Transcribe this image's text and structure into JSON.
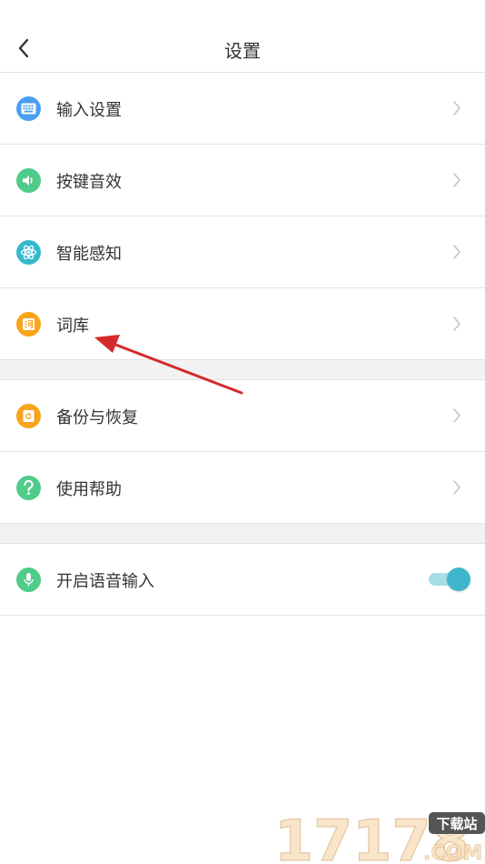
{
  "header": {
    "title": "设置"
  },
  "group1": {
    "items": [
      {
        "label": "输入设置",
        "icon": "keyboard-icon",
        "color": "#4a9ff0"
      },
      {
        "label": "按键音效",
        "icon": "speaker-icon",
        "color": "#4fcb8a"
      },
      {
        "label": "智能感知",
        "icon": "atom-icon",
        "color": "#35b9cc"
      },
      {
        "label": "词库",
        "icon": "dictionary-icon",
        "color": "#f7a51b"
      }
    ]
  },
  "group2": {
    "items": [
      {
        "label": "备份与恢复",
        "icon": "backup-icon",
        "color": "#f7a51b"
      },
      {
        "label": "使用帮助",
        "icon": "help-icon",
        "color": "#4fcb8a"
      }
    ]
  },
  "group3": {
    "items": [
      {
        "label": "开启语音输入",
        "icon": "microphone-icon",
        "color": "#4fcb8a",
        "toggle": true
      }
    ]
  },
  "watermark": {
    "text": "17178",
    "badge": "下载站",
    "suffix": ".COM"
  }
}
